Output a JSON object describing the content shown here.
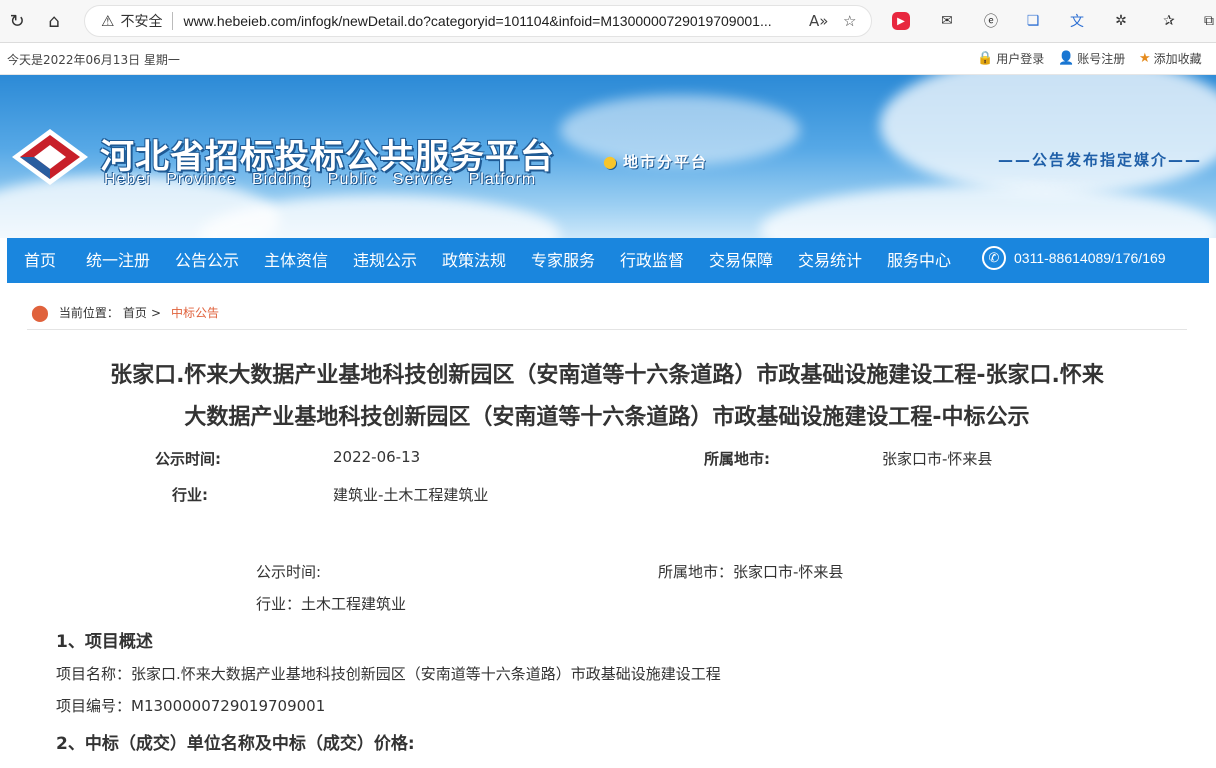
{
  "browser": {
    "security_label": "不安全",
    "url": "www.hebeieb.com/infogk/newDetail.do?categoryid=101104&infoid=M1300000729019709001..."
  },
  "util": {
    "date": "今天是2022年06月13日 星期一",
    "login": "用户登录",
    "register": "账号注册",
    "favorite": "添加收藏"
  },
  "banner": {
    "title_cn": "河北省招标投标公共服务平台",
    "title_en": "Hebei Province Bidding Public Service Platform",
    "city": "地市分平台",
    "media": "——公告发布指定媒介——"
  },
  "nav": {
    "items": [
      "首页",
      "统一注册",
      "公告公示",
      "主体资信",
      "违规公示",
      "政策法规",
      "专家服务",
      "行政监督",
      "交易保障",
      "交易统计",
      "服务中心"
    ],
    "phone": "0311-88614089/176/169"
  },
  "breadcrumb": {
    "label": "当前位置：",
    "home": "首页",
    "arrow": ">",
    "current": "中标公告"
  },
  "article": {
    "title_line1": "张家口.怀来大数据产业基地科技创新园区（安南道等十六条道路）市政基础设施建设工程-张家口.怀来",
    "title_line2": "大数据产业基地科技创新园区（安南道等十六条道路）市政基础设施建设工程-中标公示",
    "meta": {
      "time_label": "公示时间:",
      "time_value": "2022-06-13",
      "area_label": "所属地市:",
      "area_value": "张家口市-怀来县",
      "industry_label": "行业:",
      "industry_value": "建筑业-土木工程建筑业"
    },
    "sub_meta": {
      "time": "公示时间:",
      "area": "所属地市：张家口市-怀来县",
      "industry": "行业：土木工程建筑业"
    },
    "sections": {
      "s1_heading": "1、项目概述",
      "project_name": "项目名称：张家口.怀来大数据产业基地科技创新园区（安南道等十六条道路）市政基础设施建设工程",
      "project_code": "项目编号：M1300000729019709001",
      "s2_heading": "2、中标（成交）单位名称及中标（成交）价格:"
    }
  },
  "colors": {
    "nav_blue": "#1a86de",
    "accent_orange": "#e0623c"
  }
}
